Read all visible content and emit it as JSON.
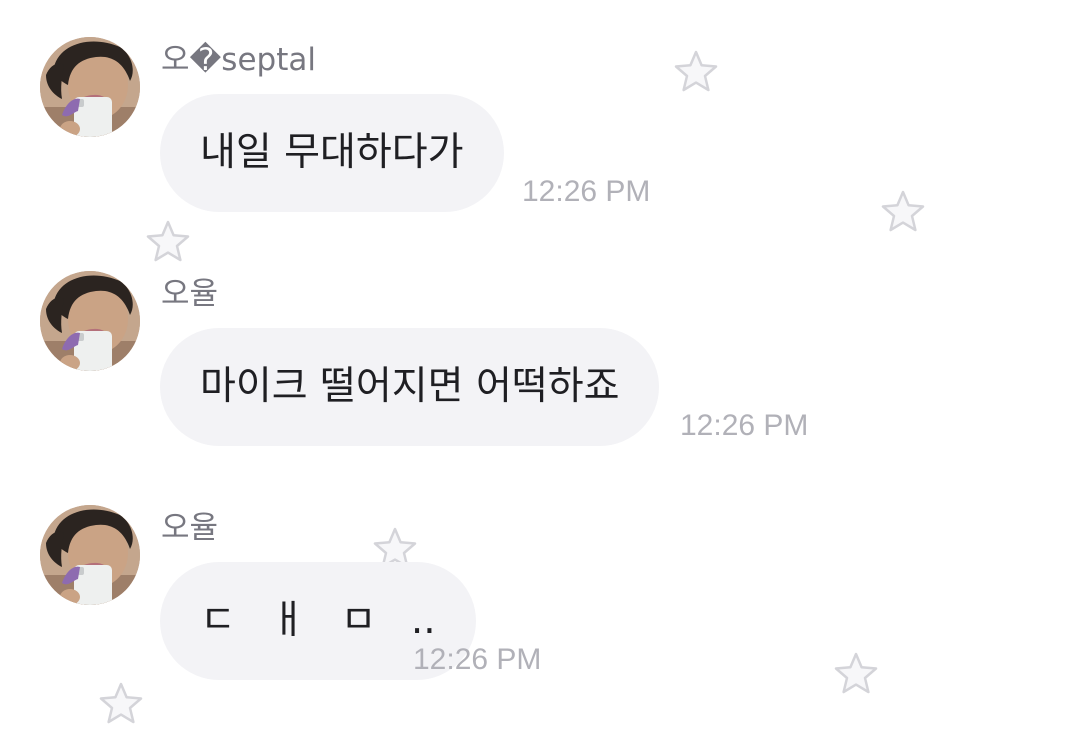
{
  "messages": [
    {
      "sender": "오�septal",
      "text": "내일 무대하다가",
      "time": "12:26 PM"
    },
    {
      "sender": "오율",
      "text": "마이크 떨어지면 어떡하죠",
      "time": "12:26 PM"
    },
    {
      "sender": "오율",
      "text": "ㄷ ㅐ ㅁ ..",
      "time": "12:26 PM"
    }
  ],
  "icons": {
    "avatar": "profile-photo-avatar",
    "decoration": "star-icon"
  },
  "colors": {
    "bubble": "#f3f3f6",
    "message_text": "#1f1f23",
    "sender": "#777780",
    "time": "#b1b1b8",
    "star_outline": "#d4d4d9"
  }
}
